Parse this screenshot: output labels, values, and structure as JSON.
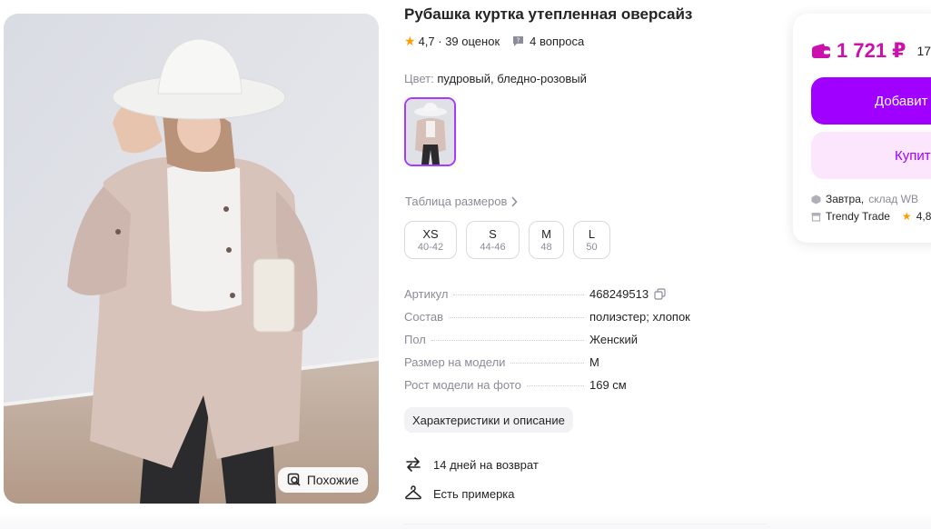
{
  "product": {
    "title": "Рубашка куртка утепленная оверсайз",
    "rating": "4,7",
    "reviews": "39 оценок",
    "questions": "4 вопроса",
    "similar_label": "Похожие"
  },
  "color": {
    "label": "Цвет:",
    "value": "пудровый, бледно-розовый"
  },
  "size_table_link": "Таблица размеров",
  "sizes": [
    {
      "name": "XS",
      "range": "40-42"
    },
    {
      "name": "S",
      "range": "44-46"
    },
    {
      "name": "M",
      "range": "48"
    },
    {
      "name": "L",
      "range": "50"
    }
  ],
  "specs": [
    {
      "key": "Артикул",
      "value": "468249513"
    },
    {
      "key": "Состав",
      "value": "полиэстер; хлопок"
    },
    {
      "key": "Пол",
      "value": "Женский"
    },
    {
      "key": "Размер на модели",
      "value": "M"
    },
    {
      "key": "Рост модели на фото",
      "value": "169 см"
    }
  ],
  "characteristics_button": "Характеристики и описание",
  "features": {
    "return": "14 дней на возврат",
    "fitting": "Есть примерка"
  },
  "buy": {
    "price": "1 721 ₽",
    "old_price": "17",
    "add_label": "Добавит",
    "buy_label": "Купит",
    "delivery_day": "Завтра,",
    "delivery_where": "склад WB",
    "seller_name": "Trendy Trade",
    "seller_rating": "4,8"
  },
  "colors": {
    "accent": "#a000ff",
    "price": "#cb11ab",
    "star": "#ff9d00",
    "muted": "#8b8b99"
  }
}
